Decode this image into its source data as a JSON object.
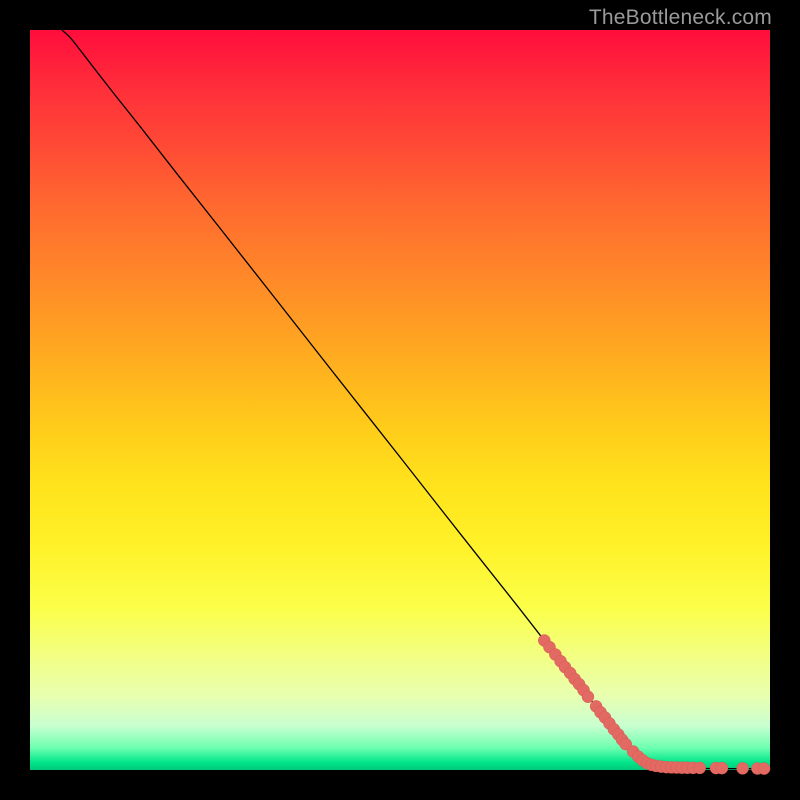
{
  "watermark": "TheBottleneck.com",
  "colors": {
    "bg": "#000000",
    "curve": "#000000",
    "dot_fill": "#e26a63",
    "dot_stroke": "#d85a53"
  },
  "chart_data": {
    "type": "line",
    "title": "",
    "xlabel": "",
    "ylabel": "",
    "xlim": [
      0,
      100
    ],
    "ylim": [
      0,
      100
    ],
    "grid": false,
    "curve": {
      "description": "Monotone decreasing curve from top-left to bottom-right with a soft shoulder near the top-left then essentially linear descent to the bottom edge.",
      "points": [
        {
          "x": 4.3,
          "y": 100.0
        },
        {
          "x": 5.5,
          "y": 98.9
        },
        {
          "x": 7.0,
          "y": 97.0
        },
        {
          "x": 9.0,
          "y": 94.4
        },
        {
          "x": 11.5,
          "y": 91.2
        },
        {
          "x": 15.0,
          "y": 86.8
        },
        {
          "x": 20.0,
          "y": 80.4
        },
        {
          "x": 26.0,
          "y": 72.8
        },
        {
          "x": 33.0,
          "y": 63.9
        },
        {
          "x": 41.0,
          "y": 53.7
        },
        {
          "x": 50.0,
          "y": 42.3
        },
        {
          "x": 58.0,
          "y": 32.1
        },
        {
          "x": 66.0,
          "y": 22.0
        },
        {
          "x": 72.0,
          "y": 14.3
        },
        {
          "x": 77.2,
          "y": 7.7
        },
        {
          "x": 80.4,
          "y": 3.6
        },
        {
          "x": 83.0,
          "y": 1.3
        },
        {
          "x": 85.0,
          "y": 0.5
        },
        {
          "x": 88.0,
          "y": 0.28
        },
        {
          "x": 92.0,
          "y": 0.2
        },
        {
          "x": 96.0,
          "y": 0.18
        },
        {
          "x": 99.5,
          "y": 0.17
        }
      ]
    },
    "markers": {
      "radius_px": 6,
      "points": [
        {
          "x": 69.5,
          "y": 17.5
        },
        {
          "x": 70.2,
          "y": 16.6
        },
        {
          "x": 71.0,
          "y": 15.6
        },
        {
          "x": 71.7,
          "y": 14.7
        },
        {
          "x": 72.3,
          "y": 13.9
        },
        {
          "x": 73.0,
          "y": 13.1
        },
        {
          "x": 73.6,
          "y": 12.3
        },
        {
          "x": 74.2,
          "y": 11.6
        },
        {
          "x": 74.8,
          "y": 10.8
        },
        {
          "x": 75.4,
          "y": 9.9
        },
        {
          "x": 76.5,
          "y": 8.6
        },
        {
          "x": 77.1,
          "y": 7.8
        },
        {
          "x": 77.7,
          "y": 7.1
        },
        {
          "x": 78.3,
          "y": 6.3
        },
        {
          "x": 78.9,
          "y": 5.5
        },
        {
          "x": 79.5,
          "y": 4.8
        },
        {
          "x": 80.0,
          "y": 4.1
        },
        {
          "x": 80.5,
          "y": 3.5
        },
        {
          "x": 81.5,
          "y": 2.5
        },
        {
          "x": 82.2,
          "y": 1.8
        },
        {
          "x": 82.8,
          "y": 1.3
        },
        {
          "x": 83.4,
          "y": 0.9
        },
        {
          "x": 84.0,
          "y": 0.7
        },
        {
          "x": 84.6,
          "y": 0.55
        },
        {
          "x": 85.3,
          "y": 0.45
        },
        {
          "x": 86.0,
          "y": 0.38
        },
        {
          "x": 86.7,
          "y": 0.35
        },
        {
          "x": 87.4,
          "y": 0.33
        },
        {
          "x": 88.1,
          "y": 0.31
        },
        {
          "x": 88.8,
          "y": 0.3
        },
        {
          "x": 89.6,
          "y": 0.29
        },
        {
          "x": 90.5,
          "y": 0.28
        },
        {
          "x": 92.7,
          "y": 0.26
        },
        {
          "x": 93.5,
          "y": 0.25
        },
        {
          "x": 96.3,
          "y": 0.22
        },
        {
          "x": 98.3,
          "y": 0.2
        },
        {
          "x": 99.2,
          "y": 0.19
        }
      ]
    }
  }
}
